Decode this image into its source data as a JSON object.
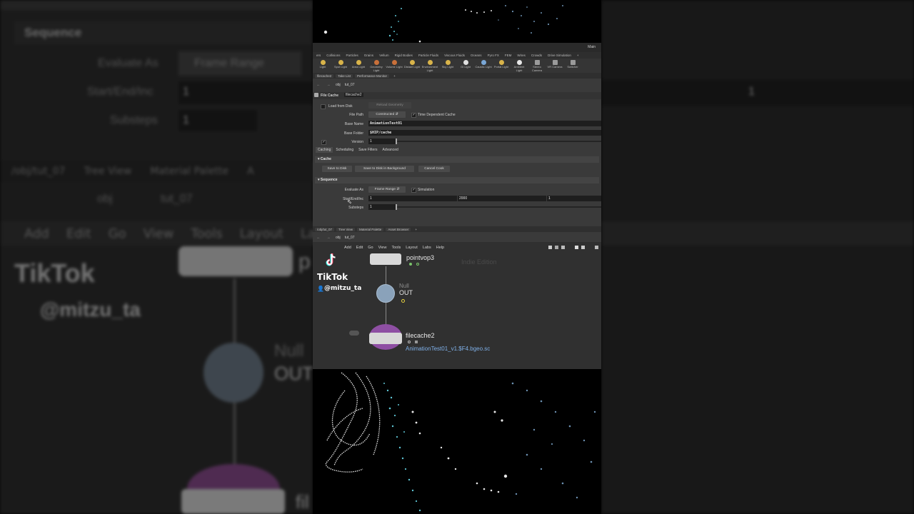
{
  "background": {
    "left_sequence_header": "Sequence",
    "left_evaluate_as_label": "Evaluate As",
    "left_evaluate_as_value": "Frame Range",
    "left_start_end_inc_label": "Start/End/Inc",
    "left_start_value": "1",
    "left_substeps_label": "Substeps",
    "left_substeps_value": "1",
    "left_tabs": [
      "/obj/tut_07",
      "Tree View",
      "Material Palette",
      "A"
    ],
    "left_path_obj": "obj",
    "left_path_network": "tut_07",
    "left_menu": [
      "Add",
      "Edit",
      "Go",
      "View",
      "Tools",
      "Layout",
      "Lab"
    ],
    "left_node_p": "p",
    "left_node_null": "Null",
    "left_node_out": "OUT",
    "left_node_fil": "fil",
    "left_tiktok": "TikTok",
    "left_user": "@mitzu_ta",
    "right_value": "1"
  },
  "houdini": {
    "desktop_label": "Main",
    "shelf_tabs": [
      "ers",
      "Collisions",
      "Particles",
      "Grains",
      "Vellum",
      "Rigid Bodies",
      "Particle Fluids",
      "Viscous Fluids",
      "Oceans",
      "Pyro FX",
      "FEM",
      "Wires",
      "Crowds",
      "Drive Simulation"
    ],
    "shelf_tools": [
      "Light",
      "Spot Light",
      "Area Light",
      "Geometry Light",
      "Volume Light",
      "Distant Light",
      "Environment Light",
      "Sky Light",
      "GI Light",
      "Caustic Light",
      "Portal Light",
      "Ambient Light",
      "Stereo Camera",
      "VR Camera",
      "Switcher"
    ],
    "panel_tabs": [
      "filecache2",
      "Take List",
      "Performance Monitor"
    ],
    "path_obj": "obj",
    "path_network": "tut_07",
    "node_type": "File Cache",
    "node_name": "filecache2",
    "load_from_disk_label": "Load from Disk",
    "reload_geometry_label": "Reload Geometry",
    "file_path_label": "File Path",
    "file_path_value": "Constructed",
    "time_dependent_label": "Time Dependent Cache",
    "base_name_label": "Base Name",
    "base_name_value": "AnimationTest01",
    "base_folder_label": "Base Folder",
    "base_folder_value": "$HIP/cache",
    "version_label": "Version",
    "version_value": "1",
    "parm_tabs": [
      "Caching",
      "Scheduling",
      "Save Filters",
      "Advanced"
    ],
    "cache_section": "Cache",
    "save_to_disk": "Save to Disk",
    "save_to_disk_bg": "Save to Disk in Background",
    "cancel_cook": "Cancel Cook",
    "sequence_section": "Sequence",
    "evaluate_as_label": "Evaluate As",
    "evaluate_as_value": "Frame Range",
    "simulation_label": "Simulation",
    "start_end_inc_label": "Start/End/Inc",
    "start_value": "1",
    "end_value": "2000",
    "inc_value": "1",
    "substeps_label": "Substeps",
    "substeps_value": "1"
  },
  "network": {
    "tabs": [
      "/obj/tut_07",
      "Tree View",
      "Material Palette",
      "Asset Browser"
    ],
    "path_obj": "obj",
    "path_network": "tut_07",
    "menu": [
      "Add",
      "Edit",
      "Go",
      "View",
      "Tools",
      "Layout",
      "Labs",
      "Help"
    ],
    "watermark": "Indie Edition",
    "node1_name": "pointvop3",
    "node2_type": "Null",
    "node2_name": "OUT",
    "node3_name": "filecache2",
    "node3_output": "AnimationTest01_v1.$F4.bgeo.sc"
  },
  "overlay": {
    "brand": "TikTok",
    "user": "@mitzu_ta"
  },
  "colors": {
    "panel": "#3a3a3a",
    "field": "#1e1e1e",
    "network_bg": "#303030",
    "link_blue": "#7fb0e8",
    "particle_cyan": "#5fc7d6",
    "particle_white": "#e6e6e6"
  }
}
